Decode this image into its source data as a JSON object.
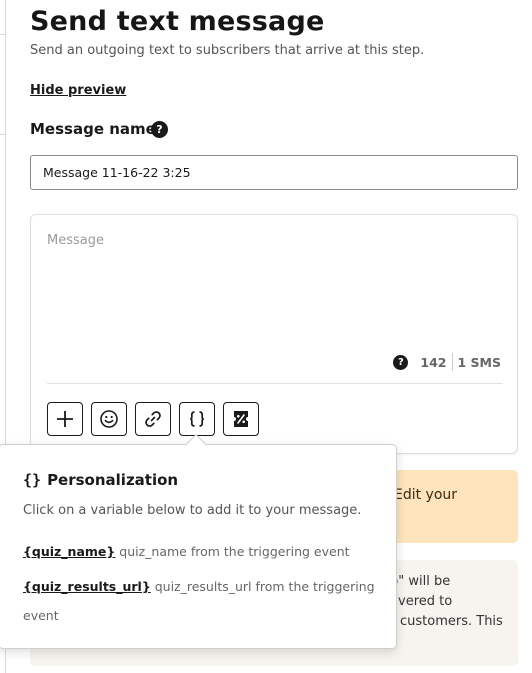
{
  "header": {
    "title": "Send text message",
    "subtitle": "Send an outgoing text to subscribers that arrive at this step.",
    "hide_preview_label": "Hide preview"
  },
  "message_name": {
    "label": "Message name",
    "help_glyph": "?",
    "value": "Message 11-16-22 3:25"
  },
  "composer": {
    "placeholder": "Message",
    "char_remaining": "142",
    "sms_count": "1 SMS",
    "help_glyph": "?",
    "toolbar_icons": [
      "plus-icon",
      "emoji-icon",
      "link-icon",
      "braces-icon",
      "discount-tag-icon"
    ]
  },
  "banners": {
    "warning_fragment": "Edit your",
    "info_fragments": [
      "p\" will be",
      "vered to",
      "customers. This"
    ]
  },
  "personalization": {
    "braces_glyph": "{}",
    "title": "Personalization",
    "description": "Click on a variable below to add it to your message.",
    "variables": [
      {
        "token": "{quiz_name}",
        "description": "quiz_name from the triggering event"
      },
      {
        "token": "{quiz_results_url}",
        "description": "quiz_results_url from the triggering event"
      }
    ]
  },
  "colors": {
    "warning_bg": "#fde4bd",
    "info_bg": "#f7f3ee",
    "text_primary": "#1a1a1a"
  }
}
